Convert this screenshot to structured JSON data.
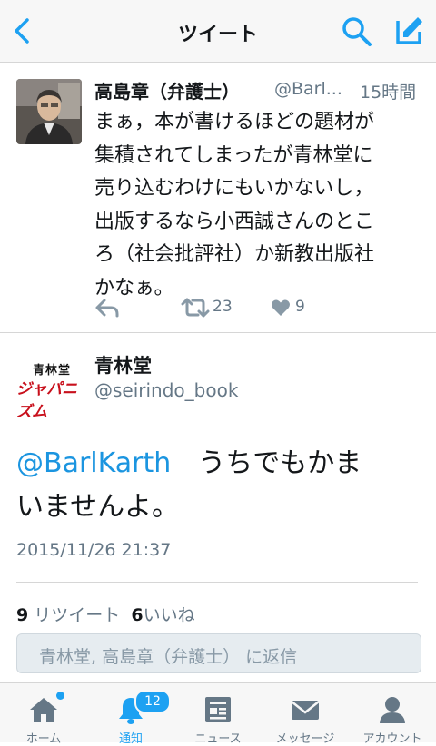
{
  "nav": {
    "title": "ツイート"
  },
  "tweet": {
    "author_name": "高島章（弁護士）",
    "handle": "@Barl...",
    "time": "15時間",
    "text_lines": [
      "まぁ，本が書けるほどの題材が",
      "集積されてしまったが青林堂に",
      "売り込むわけにもいかないし，",
      "出版するなら小西誠さんのとこ",
      "ろ（社会批評社）か新教出版社",
      "かなぁ。"
    ],
    "retweet_count": "23",
    "like_count": "9"
  },
  "detail": {
    "logo_top": "青林堂",
    "logo_bottom": "ジャパニズム",
    "author_name": "青林堂",
    "handle": "@seirindo_book",
    "mention": "@BarlKarth",
    "text_after_mention": "　うちでもかま",
    "text_line2": "いませんよ。",
    "date": "2015/11/26 21:37",
    "retweets_num": "9",
    "retweets_label": "リツイート",
    "likes_num": "6",
    "likes_label": "いいね"
  },
  "reply": {
    "placeholder": "青林堂, 高島章（弁護士） に返信"
  },
  "tabs": {
    "home": "ホーム",
    "notifications": "通知",
    "notifications_badge": "12",
    "news": "ニュース",
    "messages": "メッセージ",
    "account": "アカウント"
  },
  "colors": {
    "accent": "#1da1f2",
    "mention": "#1b95e0",
    "logo_red": "#c8101c"
  }
}
